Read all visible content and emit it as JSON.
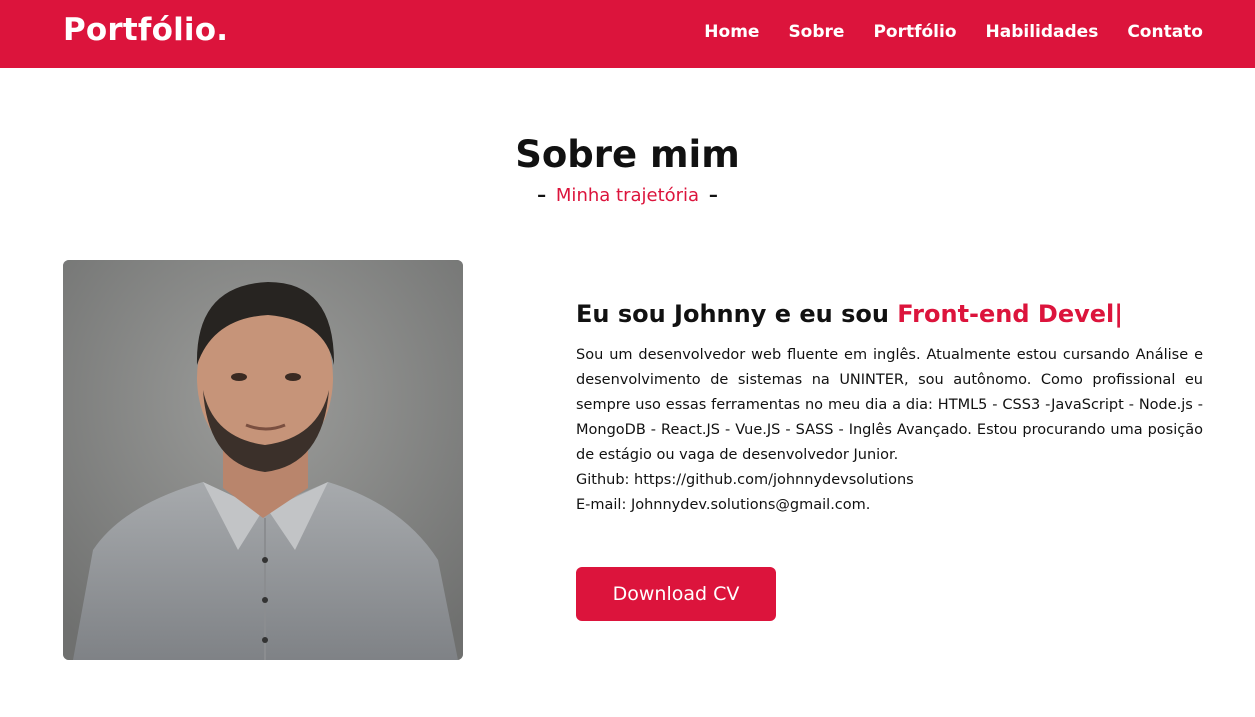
{
  "colors": {
    "accent": "#dc143c",
    "text": "#111111",
    "background": "#ffffff"
  },
  "navbar": {
    "logo": "Portfólio.",
    "items": [
      {
        "label": "Home"
      },
      {
        "label": "Sobre"
      },
      {
        "label": "Portfólio"
      },
      {
        "label": "Habilidades"
      },
      {
        "label": "Contato"
      }
    ]
  },
  "about": {
    "title": "Sobre mim",
    "subtitle_dash_left": "–",
    "subtitle": "Minha trajetória",
    "subtitle_dash_right": "–",
    "headline_prefix": "Eu sou Johnny e eu sou",
    "headline_typed": "Front-end Devel",
    "headline_cursor": "|",
    "bio": "Sou um desenvolvedor web fluente em inglês. Atualmente estou cursando Análise e desenvolvimento de sistemas na UNINTER, sou autônomo. Como profissional eu sempre uso essas ferramentas no meu dia a dia: HTML5 - CSS3 -JavaScript - Node.js - MongoDB - React.JS - Vue.JS - SASS - Inglês Avançado. Estou procurando uma posição de estágio ou vaga de desenvolvedor Junior.",
    "github": "Github: https://github.com/johnnydevsolutions",
    "email": "E-mail: Johnnydev.solutions@gmail.com.",
    "button_label": "Download CV"
  }
}
